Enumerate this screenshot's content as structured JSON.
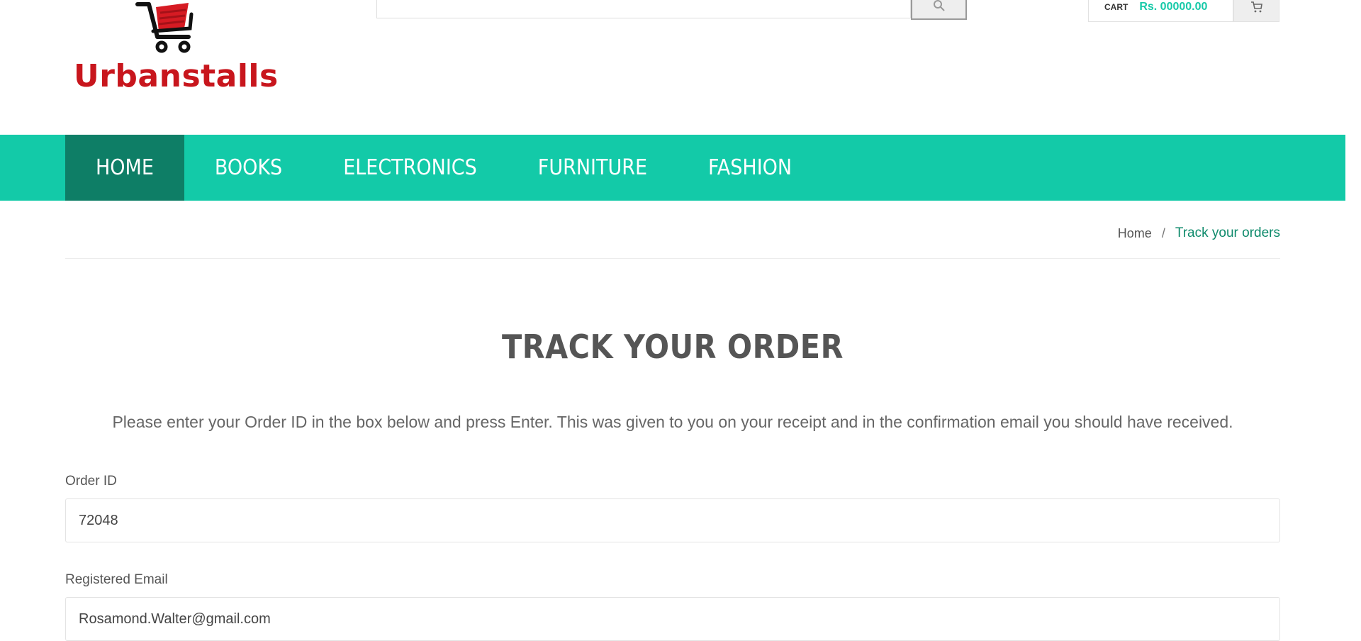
{
  "brand": {
    "name": "Urbanstalls",
    "logo_color": "#c8161d"
  },
  "header": {
    "search": {
      "value": "",
      "icon": "search-icon"
    },
    "cart": {
      "label": "CART",
      "total": "Rs. 00000.00",
      "icon": "cart-icon",
      "accent_color": "#16c9a8"
    }
  },
  "nav": {
    "background_color": "#13caa8",
    "active_color": "#0e7e66",
    "items": [
      {
        "label": "HOME",
        "active": true
      },
      {
        "label": "BOOKS",
        "active": false
      },
      {
        "label": "ELECTRONICS",
        "active": false
      },
      {
        "label": "FURNITURE",
        "active": false
      },
      {
        "label": "FASHION",
        "active": false
      }
    ]
  },
  "breadcrumb": {
    "home": "Home",
    "separator": "/",
    "current": "Track your orders"
  },
  "main": {
    "title": "TRACK YOUR ORDER",
    "intro": "Please enter your Order ID in the box below and press Enter. This was given to you on your receipt and in the confirmation email you should have received.",
    "order_id": {
      "label": "Order ID",
      "value": "72048"
    },
    "email": {
      "label": "Registered Email",
      "value": "Rosamond.Walter@gmail.com"
    }
  }
}
